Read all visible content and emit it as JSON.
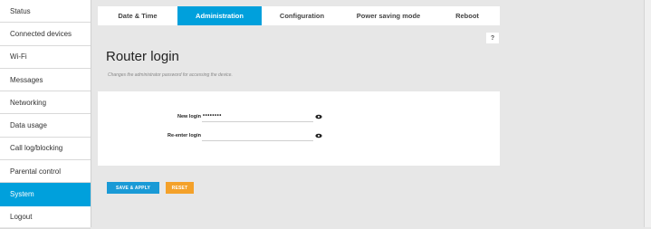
{
  "sidebar": {
    "items": [
      {
        "label": "Status"
      },
      {
        "label": "Connected devices"
      },
      {
        "label": "Wi-Fi"
      },
      {
        "label": "Messages"
      },
      {
        "label": "Networking"
      },
      {
        "label": "Data usage"
      },
      {
        "label": "Call log/blocking"
      },
      {
        "label": "Parental control"
      },
      {
        "label": "System",
        "active": true
      },
      {
        "label": "Logout"
      }
    ]
  },
  "tabs": [
    {
      "label": "Date & Time"
    },
    {
      "label": "Administration",
      "active": true
    },
    {
      "label": "Configuration"
    },
    {
      "label": "Power saving mode"
    },
    {
      "label": "Reboot"
    }
  ],
  "help": {
    "label": "?"
  },
  "panel": {
    "title": "Router login",
    "description": "Changes the administrator password for accessing the device."
  },
  "form": {
    "new_login": {
      "label": "New login",
      "value": "••••••••"
    },
    "reenter_login": {
      "label": "Re-enter login",
      "value": ""
    }
  },
  "buttons": {
    "save_apply": "SAVE & APPLY",
    "reset": "RESET"
  },
  "colors": {
    "accent": "#00a0dc",
    "reset": "#f4a12a"
  }
}
